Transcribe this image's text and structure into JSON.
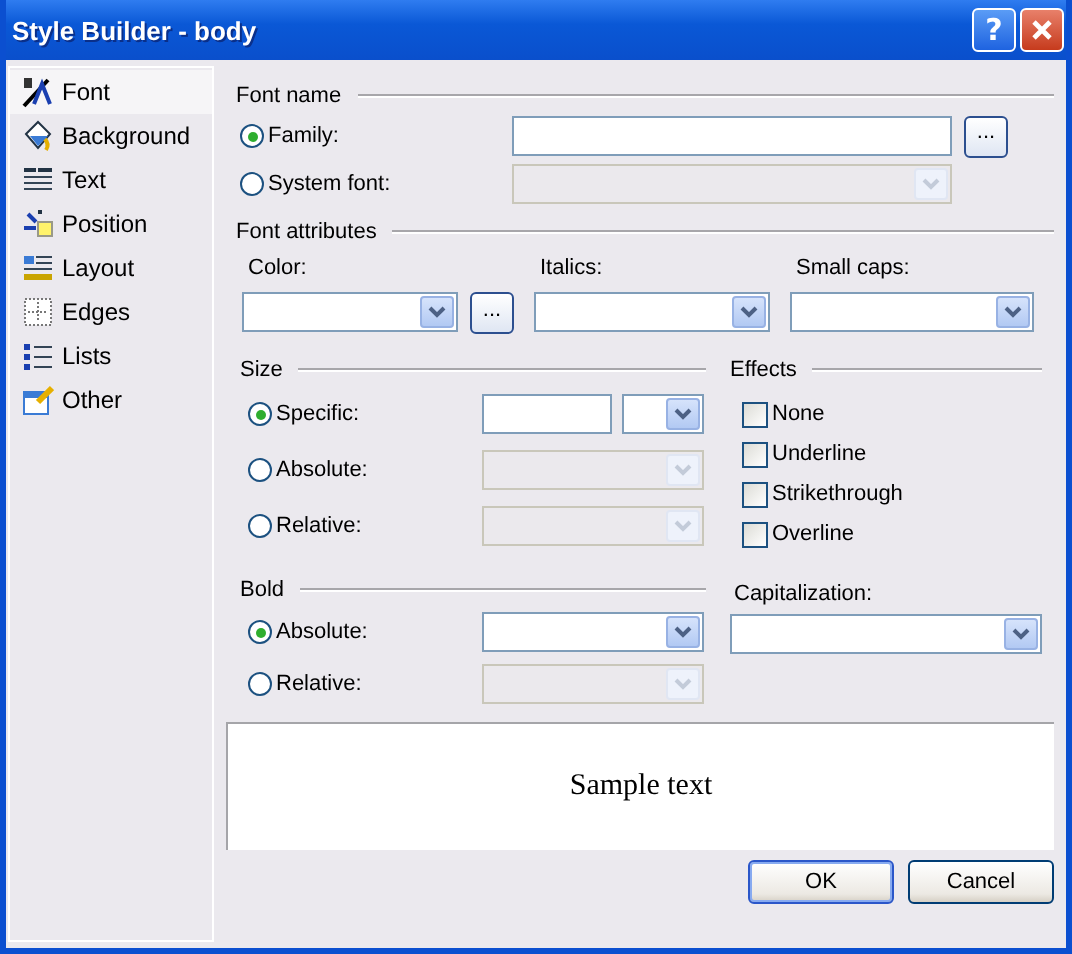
{
  "window": {
    "title": "Style Builder - body",
    "help": "?"
  },
  "sidebar": {
    "items": [
      {
        "label": "Font",
        "selected": true
      },
      {
        "label": "Background",
        "selected": false
      },
      {
        "label": "Text",
        "selected": false
      },
      {
        "label": "Position",
        "selected": false
      },
      {
        "label": "Layout",
        "selected": false
      },
      {
        "label": "Edges",
        "selected": false
      },
      {
        "label": "Lists",
        "selected": false
      },
      {
        "label": "Other",
        "selected": false
      }
    ]
  },
  "font_name": {
    "heading": "Font name",
    "browse_button": "...",
    "options": [
      {
        "label": "Family:",
        "selected": true,
        "kind": "text",
        "disabled": false
      },
      {
        "label": "System font:",
        "selected": false,
        "kind": "select",
        "disabled": true
      }
    ]
  },
  "font_attributes": {
    "heading": "Font attributes",
    "color_button": "...",
    "fields": [
      {
        "label": "Color:"
      },
      {
        "label": "Italics:"
      },
      {
        "label": "Small caps:"
      }
    ]
  },
  "size": {
    "heading": "Size",
    "options": [
      {
        "label": "Specific:",
        "selected": true,
        "disabled": false
      },
      {
        "label": "Absolute:",
        "selected": false,
        "disabled": true
      },
      {
        "label": "Relative:",
        "selected": false,
        "disabled": true
      }
    ]
  },
  "effects": {
    "heading": "Effects",
    "options": [
      {
        "label": "None",
        "checked": false
      },
      {
        "label": "Underline",
        "checked": false
      },
      {
        "label": "Strikethrough",
        "checked": false
      },
      {
        "label": "Overline",
        "checked": false
      }
    ]
  },
  "bold": {
    "heading": "Bold",
    "options": [
      {
        "label": "Absolute:",
        "selected": true,
        "disabled": false
      },
      {
        "label": "Relative:",
        "selected": false,
        "disabled": true
      }
    ]
  },
  "capitalization": {
    "label": "Capitalization:"
  },
  "preview": {
    "text": "Sample text"
  },
  "buttons": [
    {
      "label": "OK",
      "default": true
    },
    {
      "label": "Cancel",
      "default": false
    }
  ]
}
